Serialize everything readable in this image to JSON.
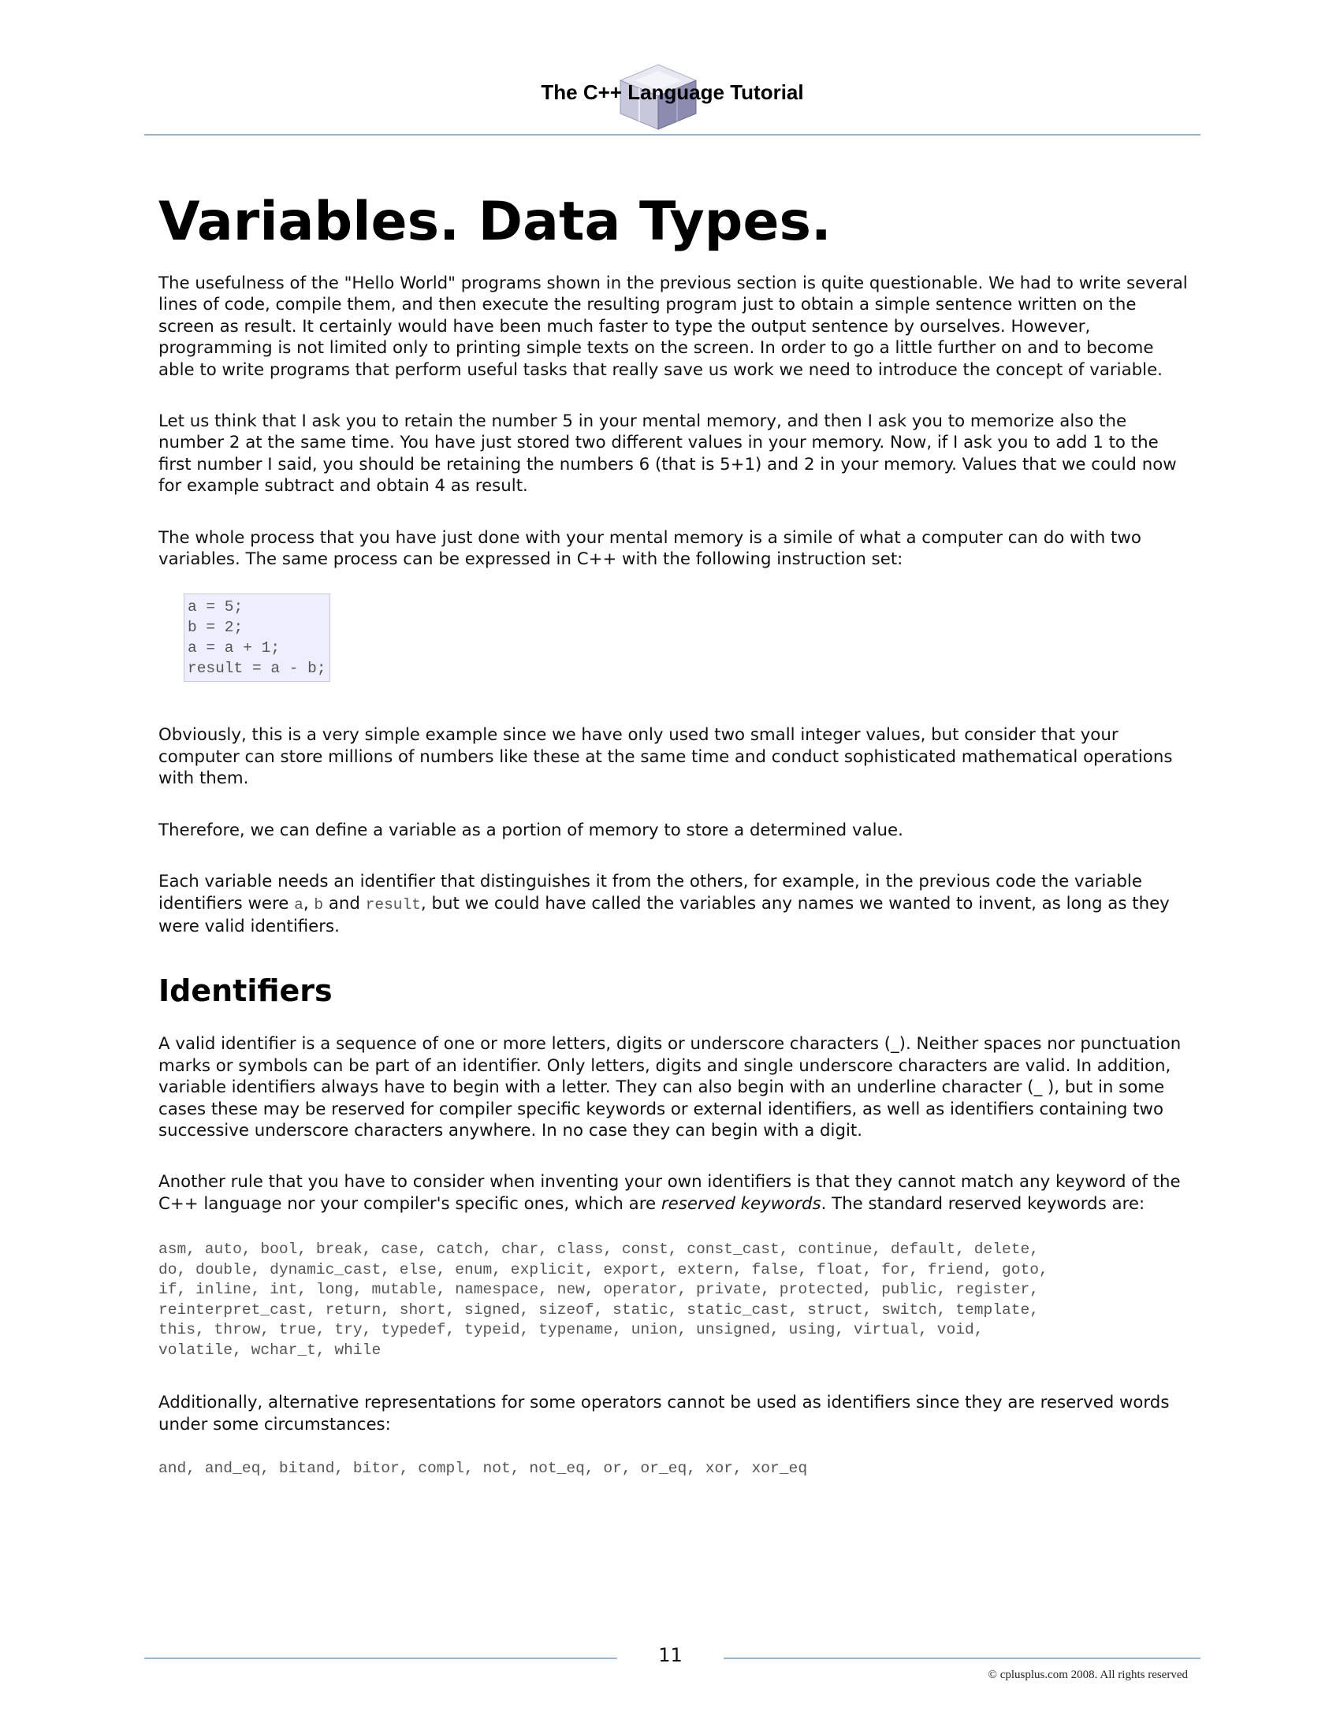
{
  "header": {
    "title": "The C++ Language Tutorial",
    "logo_icon": "isometric-cube-icon"
  },
  "page_title": "Variables. Data Types.",
  "paragraphs": {
    "p1": "The usefulness of the \"Hello World\" programs shown in the previous section is quite questionable. We had to write several lines of code, compile them, and then execute the resulting program just to obtain a simple sentence written on the screen as result. It certainly would have been much faster to type the output sentence by ourselves. However, programming is not limited only to printing simple texts on the screen. In order to go a little further on and to become able to write programs that perform useful tasks that really save us work we need to introduce the concept of variable.",
    "p2": "Let us think that I ask you to retain the number 5 in your mental memory, and then I ask you to memorize also the number 2 at the same time. You have just stored two different values in your memory. Now, if I ask you to add 1 to the first number I said, you should be retaining the numbers 6 (that is 5+1) and 2 in your memory. Values that we could now for example subtract and obtain 4 as result.",
    "p3": "The whole process that you have just done with your mental memory is a simile of what a computer can do with two variables. The same process can be expressed in C++ with the following instruction set:",
    "p4": "Obviously, this is a very simple example since we have only used two small integer values, but consider that your computer can store millions of numbers like these at the same time and conduct sophisticated mathematical operations with them.",
    "p5": "Therefore, we can define a variable as a portion of memory to store a determined value.",
    "p6": {
      "before": "Each variable needs an identifier that distinguishes it from the others, for example, in the previous code the variable identifiers were ",
      "code_a": "a",
      "comma": ", ",
      "code_b": "b",
      "and_text": " and ",
      "code_result": "result",
      "after": ", but we could have called the variables any names we wanted to invent, as long as they were valid identifiers."
    }
  },
  "code_example": {
    "lines": [
      "a = 5;",
      "b = 2;",
      "a = a + 1;",
      "result = a - b;"
    ]
  },
  "section_identifiers": {
    "heading": "Identifiers",
    "p1": "A valid identifier is a sequence of one or more letters, digits or underscore characters (_). Neither spaces nor punctuation marks or symbols can be part of an identifier. Only letters, digits and single underscore characters are valid. In addition, variable identifiers always have to begin with a letter. They can also begin with an underline character (_ ), but in some cases these may be reserved for compiler specific keywords or external identifiers, as well as identifiers containing two successive underscore characters anywhere. In no case they can begin with a digit.",
    "p2": {
      "before": "Another rule that you have to consider when inventing your own identifiers is that they cannot match any keyword of the C++ language nor your compiler's specific ones, which are ",
      "emphasis": "reserved keywords",
      "after": ". The standard reserved keywords are:"
    },
    "keyword_lines": [
      "asm, auto, bool, break, case, catch, char, class, const, const_cast, continue, default, delete,",
      "do, double, dynamic_cast, else, enum, explicit, export, extern, false, float, for, friend, goto,",
      "if, inline, int, long, mutable, namespace, new, operator, private, protected, public, register,",
      "reinterpret_cast, return, short, signed, sizeof, static, static_cast, struct, switch, template,",
      "this, throw, true, try, typedef, typeid, typename, union, unsigned, using, virtual, void,",
      "volatile, wchar_t, while"
    ],
    "p3": "Additionally, alternative representations for some operators cannot be used as identifiers since they are reserved words under some circumstances:",
    "alt_keywords": "and, and_eq, bitand, bitor, compl, not, not_eq, or, or_eq, xor, xor_eq"
  },
  "footer": {
    "page_number": "11",
    "copyright": "© cplusplus.com 2008. All rights reserved"
  },
  "colors": {
    "rule": "#9ab4cc",
    "code_background": "#eeeeff",
    "code_text": "#555555"
  }
}
